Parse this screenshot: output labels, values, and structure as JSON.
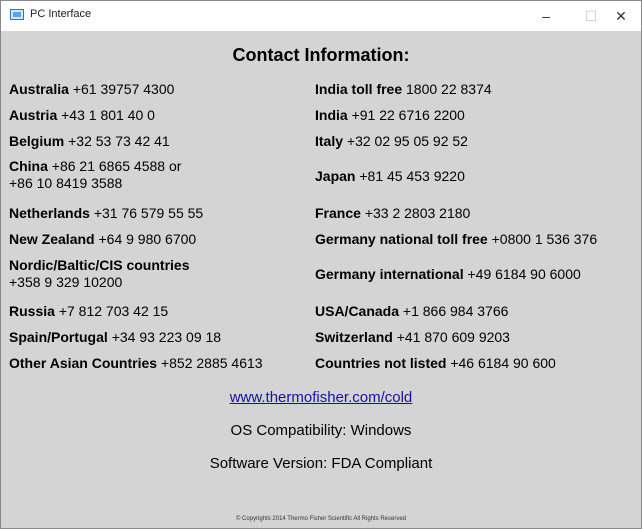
{
  "window": {
    "title": "PC Interface",
    "minimize": "–",
    "maximize": "☐",
    "close": "✕"
  },
  "heading": "Contact Information:",
  "contacts_left": [
    {
      "country": "Australia",
      "number": "+61 39757 4300"
    },
    {
      "country": "Austria",
      "number": "+43 1 801 40 0"
    },
    {
      "country": "Belgium",
      "number": "+32 53 73 42 41"
    },
    {
      "country": "China",
      "number": "+86 21 6865 4588 or",
      "number2": "+86 10 8419 3588"
    },
    {
      "country": "Netherlands",
      "number": "+31 76 579 55 55"
    },
    {
      "country": "New Zealand",
      "number": "+64 9 980 6700"
    },
    {
      "country": "Nordic/Baltic/CIS countries",
      "number": "",
      "number2": "+358 9 329 10200"
    },
    {
      "country": "Russia",
      "number": "+7 812 703 42 15"
    },
    {
      "country": "Spain/Portugal",
      "number": "+34 93 223 09 18"
    },
    {
      "country": "Other Asian Countries",
      "number": "+852 2885 4613"
    }
  ],
  "contacts_right": [
    {
      "country": "India toll free",
      "number": "1800 22 8374"
    },
    {
      "country": "India",
      "number": "+91 22 6716 2200"
    },
    {
      "country": "Italy",
      "number": "+32 02 95 05 92 52"
    },
    {
      "country": "Japan",
      "number": "+81 45 453 9220"
    },
    {
      "country": "France",
      "number": "+33 2 2803 2180"
    },
    {
      "country": "Germany national toll free",
      "number": "+0800 1 536 376"
    },
    {
      "country": "Germany international",
      "number": "+49 6184 90 6000"
    },
    {
      "country": "USA/Canada",
      "number": "+1 866 984 3766"
    },
    {
      "country": "Switzerland",
      "number": "+41 870 609 9203"
    },
    {
      "country": "Countries not listed",
      "number": "+46 6184 90 600"
    }
  ],
  "website": "www.thermofisher.com/cold",
  "os_compatibility": "OS Compatibility: Windows",
  "software_version": "Software Version: FDA Compliant",
  "copyright": "© Copyrights 2014 Thermo Fisher Scientific All Rights Reserved"
}
